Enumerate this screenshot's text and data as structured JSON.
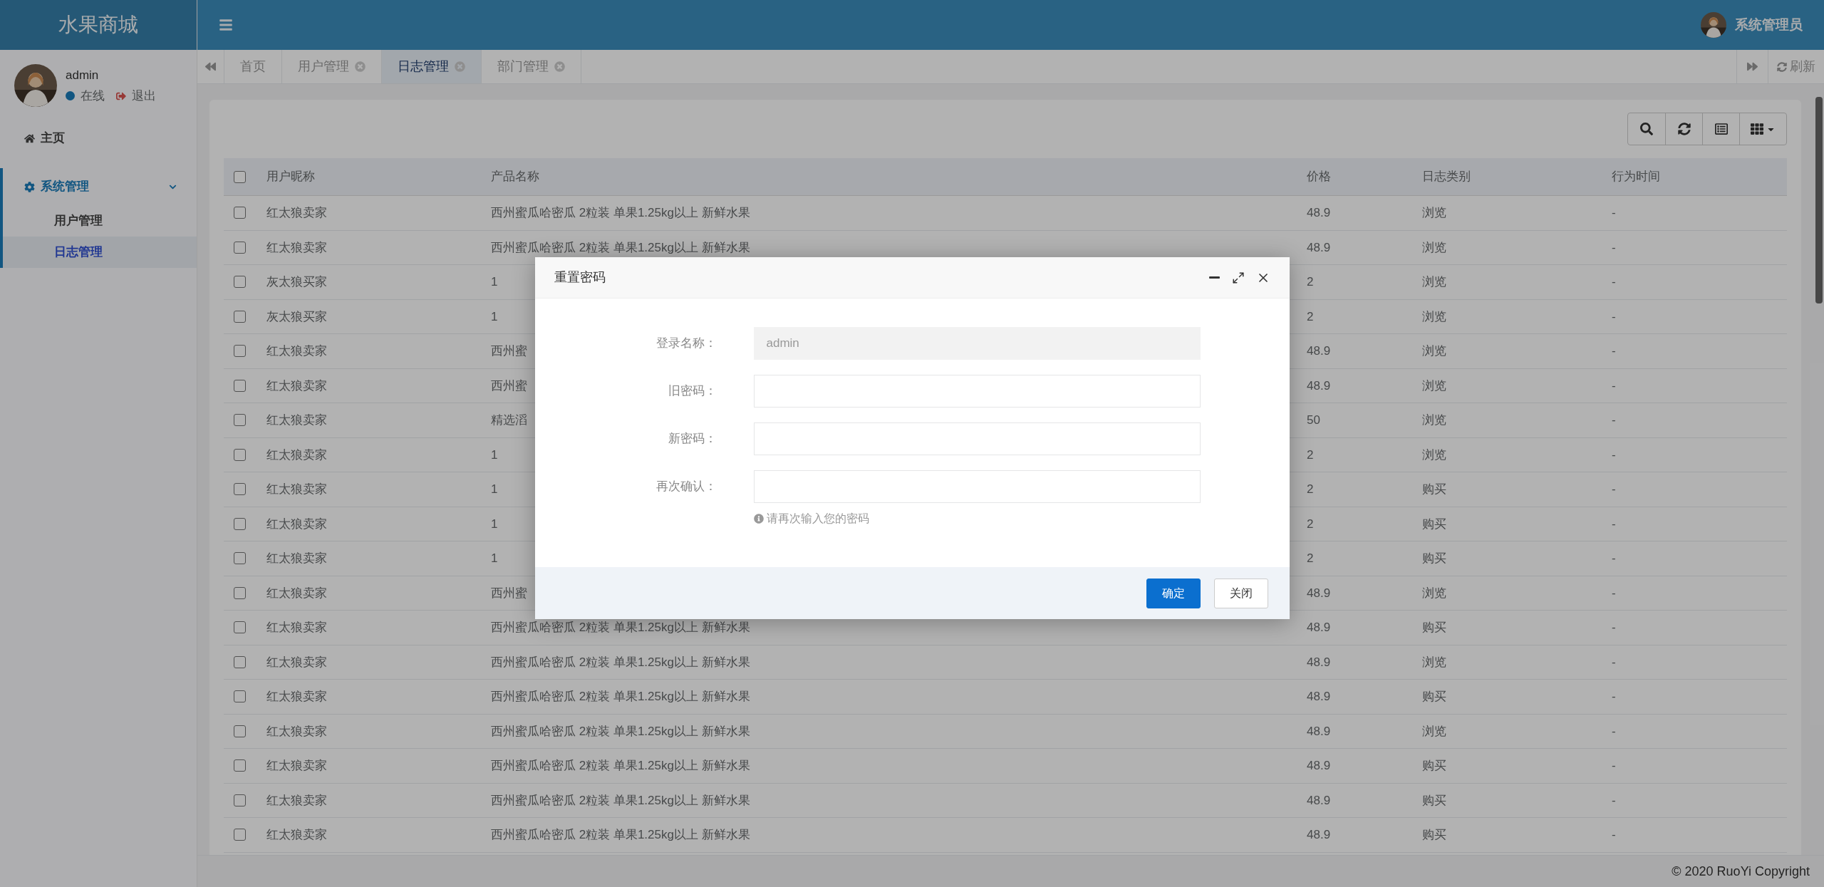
{
  "app": {
    "logo": "水果商城",
    "user_name": "系统管理员"
  },
  "sidebar": {
    "user": {
      "name": "admin",
      "status": "在线",
      "logout": "退出"
    },
    "menu": [
      {
        "kind": "link",
        "label": "主页",
        "selected": false
      },
      {
        "kind": "group",
        "label": "系统管理",
        "selected": true,
        "expanded": true,
        "children": [
          {
            "label": "用户管理",
            "selected": false
          },
          {
            "label": "日志管理",
            "selected": true
          }
        ]
      }
    ]
  },
  "tabs": [
    {
      "label": "首页",
      "selected": false,
      "closable": false
    },
    {
      "label": "用户管理",
      "selected": false,
      "closable": true
    },
    {
      "label": "日志管理",
      "selected": true,
      "closable": true
    },
    {
      "label": "部门管理",
      "selected": false,
      "closable": true
    }
  ],
  "refresh": "刷新",
  "toolbar": [
    {
      "kind": "search"
    },
    {
      "kind": "refresh"
    },
    {
      "kind": "list"
    },
    {
      "kind": "columns"
    }
  ],
  "table": {
    "all_checked": false,
    "columns": [
      "用户昵称",
      "产品名称",
      "价格",
      "日志类别",
      "行为时间"
    ],
    "rows": [
      {
        "checked": false,
        "cells": [
          "红太狼卖家",
          "西州蜜瓜哈密瓜 2粒装 单果1.25kg以上 新鲜水果",
          "48.9",
          "浏览",
          "-"
        ]
      },
      {
        "checked": false,
        "cells": [
          "红太狼卖家",
          "西州蜜瓜哈密瓜 2粒装 单果1.25kg以上 新鲜水果",
          "48.9",
          "浏览",
          "-"
        ]
      },
      {
        "checked": false,
        "cells": [
          "灰太狼买家",
          "1",
          "2",
          "浏览",
          "-"
        ]
      },
      {
        "checked": false,
        "cells": [
          "灰太狼买家",
          "1",
          "2",
          "浏览",
          "-"
        ]
      },
      {
        "checked": false,
        "cells": [
          "红太狼卖家",
          "西州蜜",
          "48.9",
          "浏览",
          "-"
        ]
      },
      {
        "checked": false,
        "cells": [
          "红太狼卖家",
          "西州蜜",
          "48.9",
          "浏览",
          "-"
        ]
      },
      {
        "checked": false,
        "cells": [
          "红太狼卖家",
          "精选滔",
          "50",
          "浏览",
          "-"
        ]
      },
      {
        "checked": false,
        "cells": [
          "红太狼卖家",
          "1",
          "2",
          "浏览",
          "-"
        ]
      },
      {
        "checked": false,
        "cells": [
          "红太狼卖家",
          "1",
          "2",
          "购买",
          "-"
        ]
      },
      {
        "checked": false,
        "cells": [
          "红太狼卖家",
          "1",
          "2",
          "购买",
          "-"
        ]
      },
      {
        "checked": false,
        "cells": [
          "红太狼卖家",
          "1",
          "2",
          "购买",
          "-"
        ]
      },
      {
        "checked": false,
        "cells": [
          "红太狼卖家",
          "西州蜜",
          "48.9",
          "浏览",
          "-"
        ]
      },
      {
        "checked": false,
        "cells": [
          "红太狼卖家",
          "西州蜜瓜哈密瓜 2粒装 单果1.25kg以上 新鲜水果",
          "48.9",
          "购买",
          "-"
        ]
      },
      {
        "checked": false,
        "cells": [
          "红太狼卖家",
          "西州蜜瓜哈密瓜 2粒装 单果1.25kg以上 新鲜水果",
          "48.9",
          "浏览",
          "-"
        ]
      },
      {
        "checked": false,
        "cells": [
          "红太狼卖家",
          "西州蜜瓜哈密瓜 2粒装 单果1.25kg以上 新鲜水果",
          "48.9",
          "购买",
          "-"
        ]
      },
      {
        "checked": false,
        "cells": [
          "红太狼卖家",
          "西州蜜瓜哈密瓜 2粒装 单果1.25kg以上 新鲜水果",
          "48.9",
          "浏览",
          "-"
        ]
      },
      {
        "checked": false,
        "cells": [
          "红太狼卖家",
          "西州蜜瓜哈密瓜 2粒装 单果1.25kg以上 新鲜水果",
          "48.9",
          "购买",
          "-"
        ]
      },
      {
        "checked": false,
        "cells": [
          "红太狼卖家",
          "西州蜜瓜哈密瓜 2粒装 单果1.25kg以上 新鲜水果",
          "48.9",
          "购买",
          "-"
        ]
      },
      {
        "checked": false,
        "cells": [
          "红太狼卖家",
          "西州蜜瓜哈密瓜 2粒装 单果1.25kg以上 新鲜水果",
          "48.9",
          "购买",
          "-"
        ]
      }
    ]
  },
  "footer": {
    "copyright": "© 2020 RuoYi Copyright"
  },
  "dialog": {
    "title": "重置密码",
    "fields": [
      {
        "label": "登录名称：",
        "value": "admin",
        "disabled": true
      },
      {
        "label": "旧密码：",
        "disabled": false
      },
      {
        "label": "新密码：",
        "disabled": false
      },
      {
        "label": "再次确认：",
        "disabled": false,
        "help": "请再次输入您的密码"
      }
    ],
    "buttons": [
      {
        "label": "确定",
        "kind": "primary"
      },
      {
        "label": "关闭",
        "kind": "default"
      }
    ]
  }
}
